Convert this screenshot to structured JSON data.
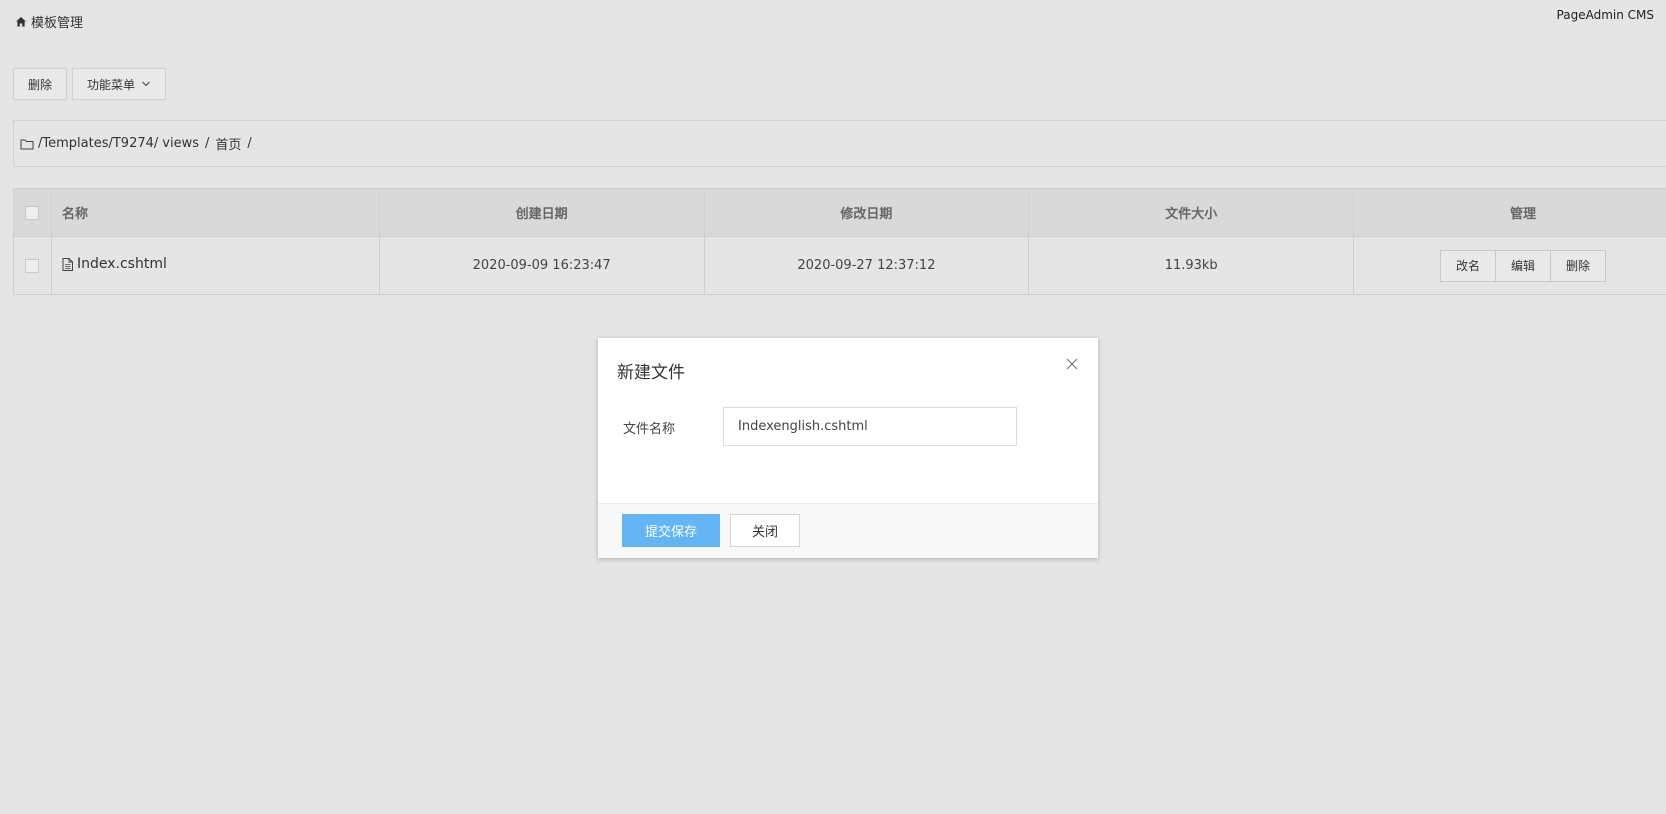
{
  "brand": "PageAdmin CMS",
  "header": {
    "title": "模板管理",
    "icon": "home-icon"
  },
  "toolbar": {
    "delete_label": "删除",
    "menu_label": "功能菜单"
  },
  "breadcrumb": {
    "icon": "folder-icon",
    "root": "/Templates/T9274/",
    "parts": [
      "views",
      "首页"
    ]
  },
  "table": {
    "headers": {
      "name": "名称",
      "created": "创建日期",
      "modified": "修改日期",
      "size": "文件大小",
      "manage": "管理"
    },
    "rows": [
      {
        "name": "Index.cshtml",
        "created": "2020-09-09 16:23:47",
        "modified": "2020-09-27 12:37:12",
        "size": "11.93kb",
        "actions": {
          "rename": "改名",
          "edit": "编辑",
          "delete": "删除"
        }
      }
    ]
  },
  "modal": {
    "title": "新建文件",
    "field_label": "文件名称",
    "field_value": "Indexenglish.cshtml",
    "submit_label": "提交保存",
    "close_label": "关闭"
  },
  "colors": {
    "primary": "#64b5f6",
    "background": "#e5e5e5"
  }
}
